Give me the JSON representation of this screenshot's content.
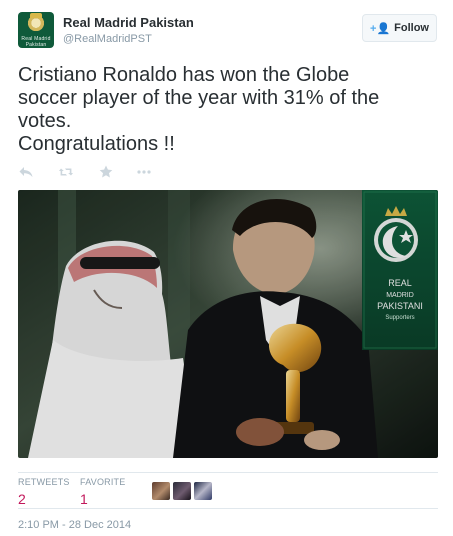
{
  "account": {
    "name": "Real Madrid Pakistan",
    "handle": "@RealMadridPST",
    "avatar_text": "Real Madrid Pakistan"
  },
  "follow_button": {
    "label": "Follow",
    "icon": "add-user-icon"
  },
  "tweet": {
    "lines": [
      "Cristiano Ronaldo has won the Globe",
      "soccer player of the year with 31% of the",
      "votes.",
      "Congratulations !!"
    ]
  },
  "actions": {
    "reply_icon": "reply-icon",
    "retweet_icon": "retweet-icon",
    "favorite_icon": "star-icon",
    "more_icon": "more-icon"
  },
  "photo": {
    "badge_line1": "REAL",
    "badge_line2": "MADRID",
    "badge_line3": "PAKISTANI",
    "badge_line4": "Supporters"
  },
  "stats": {
    "retweets_label": "RETWEETS",
    "retweets_value": "2",
    "favorites_label": "FAVORITE",
    "favorites_value": "1"
  },
  "timestamp": "2:10 PM - 28 Dec 2014",
  "colors": {
    "accent": "#55acee",
    "stat_value": "#c2185b",
    "muted": "#8899a6",
    "text": "#292f33",
    "badge_green": "#0f5a3a"
  }
}
